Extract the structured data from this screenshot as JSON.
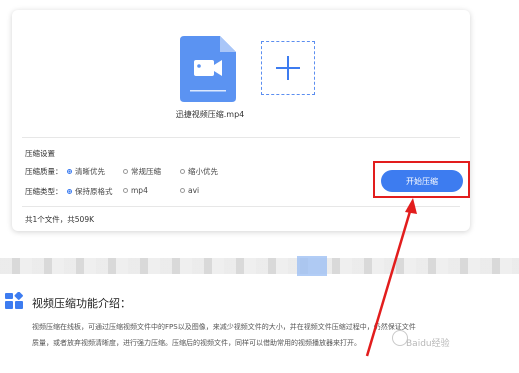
{
  "file": {
    "name": "迅捷视频压缩.mp4"
  },
  "settings": {
    "title": "压缩设置",
    "quality": {
      "label": "压缩质量：",
      "options": [
        "清晰优先",
        "常规压缩",
        "缩小优先"
      ],
      "selected": "清晰优先"
    },
    "type": {
      "label": "压缩类型：",
      "options": [
        "保持原格式",
        "mp4",
        "avi"
      ],
      "selected": "保持原格式"
    }
  },
  "start_button": {
    "label": "开始压缩"
  },
  "footer": {
    "summary": "共1个文件，共509K"
  },
  "intro": {
    "title": "视频压缩功能介绍：",
    "line1": "视频压缩在线板，可通过压缩视频文件中的FPS以及图像，来减少视频文件的大小，并在视频文件压缩过程中，仍然保证文件",
    "line2": "质量，或者放弃视频清晰度，进行强力压缩。压缩后的视频文件，同样可以借助常用的视频播放器来打开。"
  },
  "watermark": {
    "text": "Baidu经验"
  },
  "colors": {
    "accent": "#3d7cf0",
    "highlight": "#e21d1d"
  }
}
